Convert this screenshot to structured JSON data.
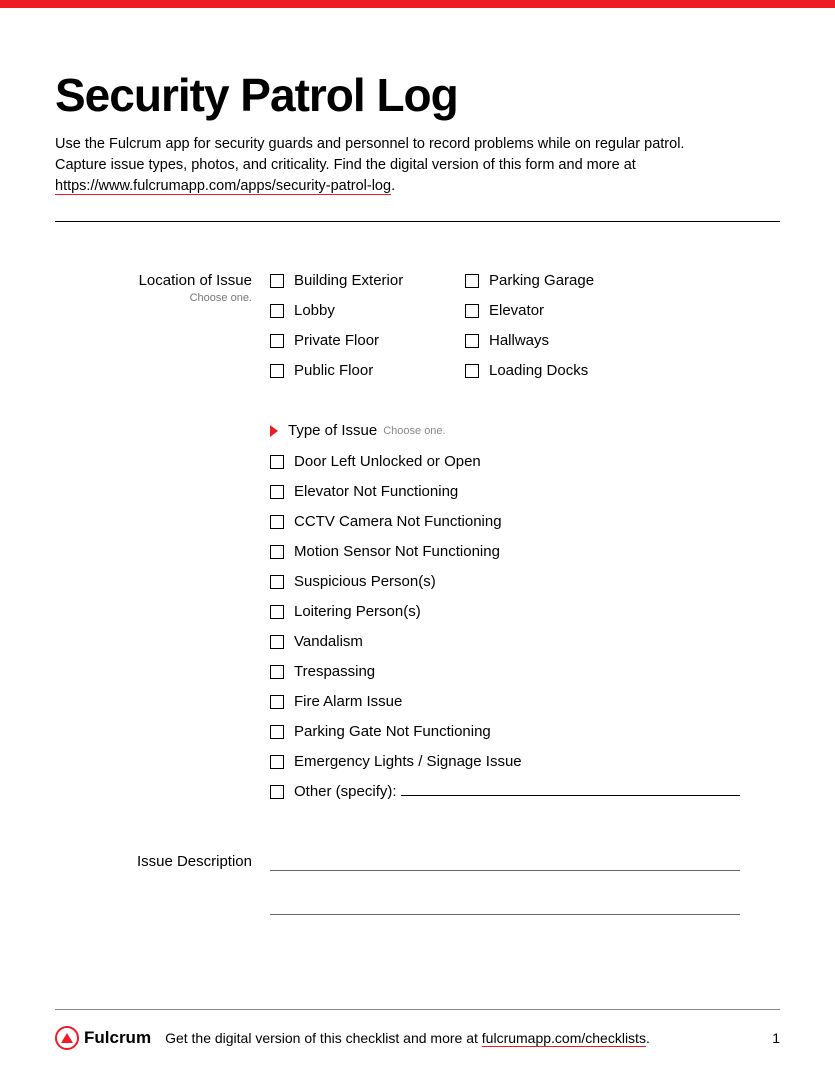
{
  "header": {
    "title": "Security Patrol Log",
    "intro_1": "Use the Fulcrum app for security guards and personnel to record problems while on regular patrol. Capture issue types, photos, and criticality. Find the digital version of this form and more at ",
    "intro_link": "https://www.fulcrumapp.com/apps/security-patrol-log",
    "intro_2": "."
  },
  "location": {
    "label": "Location of Issue",
    "sub": "Choose one.",
    "col1": [
      "Building Exterior",
      "Lobby",
      "Private Floor",
      "Public Floor"
    ],
    "col2": [
      "Parking Garage",
      "Elevator",
      "Hallways",
      "Loading Docks"
    ]
  },
  "type_of_issue": {
    "label": "Type of Issue",
    "sub": "Choose one.",
    "options": [
      "Door Left Unlocked or Open",
      "Elevator Not Functioning",
      "CCTV Camera Not Functioning",
      "Motion Sensor Not Functioning",
      "Suspicious Person(s)",
      "Loitering Person(s)",
      "Vandalism",
      "Trespassing",
      "Fire Alarm Issue",
      "Parking Gate Not Functioning",
      "Emergency Lights / Signage Issue"
    ],
    "other_label": "Other (specify):"
  },
  "issue_description": {
    "label": "Issue Description"
  },
  "footer": {
    "brand": "Fulcrum",
    "text_1": "Get the digital version of this checklist and more at ",
    "link": "fulcrumapp.com/checklists",
    "text_2": ".",
    "page": "1"
  }
}
